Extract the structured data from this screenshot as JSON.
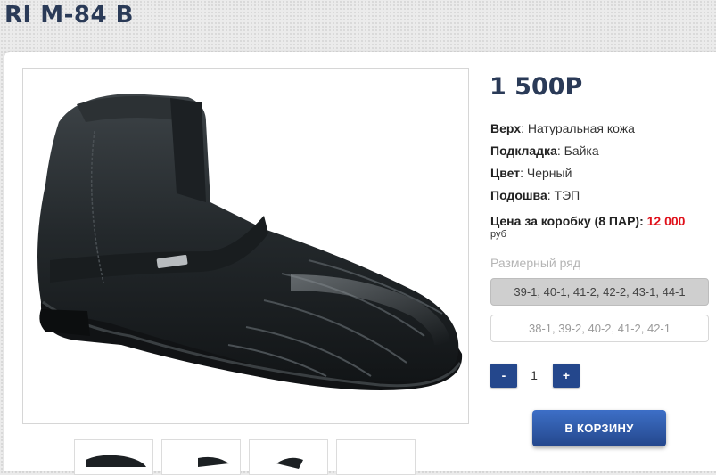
{
  "product": {
    "title": "RI M-84 B",
    "price": "1 500Р",
    "specs": [
      {
        "label": "Верх",
        "value": ": Натуральная кожа"
      },
      {
        "label": "Подкладка",
        "value": ": Байка"
      },
      {
        "label": "Цвет",
        "value": ": Черный"
      },
      {
        "label": "Подошва",
        "value": ": ТЭП"
      }
    ],
    "box_price": {
      "label": "Цена за коробку (8 ПАР): ",
      "value": "12 000",
      "unit": "руб"
    }
  },
  "sizes": {
    "label": "Размерный ряд",
    "options": [
      {
        "text": "39-1, 40-1, 41-2, 42-2, 43-1, 44-1",
        "selected": true
      },
      {
        "text": "38-1, 39-2, 40-2, 41-2, 42-1",
        "selected": false
      }
    ]
  },
  "quantity": {
    "minus": "-",
    "value": "1",
    "plus": "+"
  },
  "cart": {
    "label": "В КОРЗИНУ"
  },
  "colors": {
    "title": "#2a3a57",
    "accent": "#24478c",
    "price_red": "#e0101a"
  }
}
